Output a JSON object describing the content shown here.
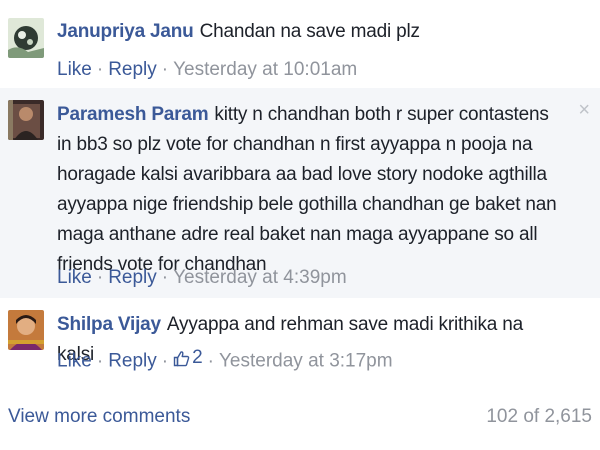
{
  "comments": [
    {
      "author": "Janupriya Janu",
      "text": "Chandan na save madi plz",
      "like_label": "Like",
      "reply_label": "Reply",
      "time": "Yesterday at 10:01am"
    },
    {
      "author": "Paramesh Param",
      "text": "kitty n chandhan both r super contastens in bb3 so plz vote for chandhan n first ayyappa n pooja na horagade kalsi avaribbara aa bad love story nodoke agthilla ayyappa nige friendship bele gothilla chandhan ge baket nan maga anthane adre real baket nan maga ayyappane so all friends vote for chandhan",
      "like_label": "Like",
      "reply_label": "Reply",
      "time": "Yesterday at 4:39pm",
      "close_glyph": "×"
    },
    {
      "author": "Shilpa Vijay",
      "text": "Ayyappa and rehman save madi krithika na kalsi",
      "like_label": "Like",
      "reply_label": "Reply",
      "like_count": "2",
      "time": "Yesterday at 3:17pm"
    }
  ],
  "footer": {
    "view_more": "View more comments",
    "count": "102 of 2,615"
  },
  "colors": {
    "link": "#3b5998",
    "meta": "#90949c",
    "text": "#1d2129",
    "highlight_bg": "#f4f6f9"
  },
  "icons": [
    "thumbs-up-icon",
    "close-icon",
    "avatar"
  ]
}
